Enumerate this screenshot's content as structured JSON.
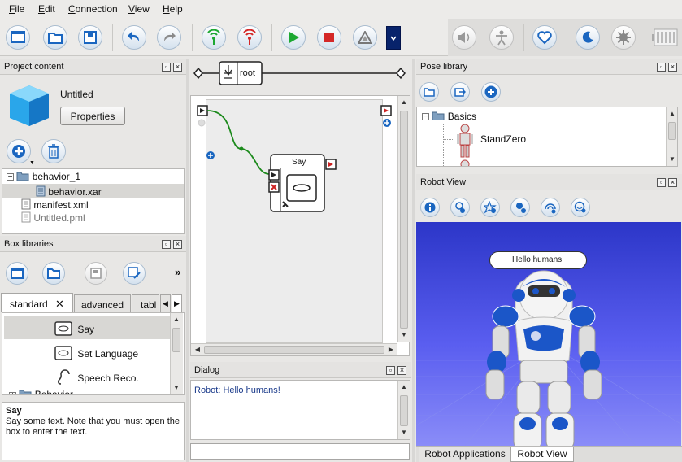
{
  "menu": {
    "file": "File",
    "edit": "Edit",
    "connection": "Connection",
    "view": "View",
    "help": "Help"
  },
  "toolbar": {
    "icons": [
      "new-file-icon",
      "open-folder-icon",
      "save-icon",
      "undo-icon",
      "redo-icon",
      "connect-icon",
      "disconnect-icon",
      "play-icon",
      "stop-icon",
      "debug-icon",
      "volume-icon",
      "stiffness-icon",
      "heart-icon",
      "sleep-icon",
      "settings-icon",
      "battery-icon"
    ],
    "accent": "#1a66c0",
    "play_color": "#1ca832",
    "stop_color": "#d42828"
  },
  "project": {
    "title": "Project content",
    "name": "Untitled",
    "properties_button": "Properties",
    "tree": [
      {
        "label": "behavior_1"
      },
      {
        "label": "behavior.xar"
      },
      {
        "label": "manifest.xml"
      },
      {
        "label": "Untitled.pml"
      }
    ]
  },
  "box_libraries": {
    "title": "Box libraries",
    "tabs": [
      "standard",
      "advanced",
      "tabl"
    ],
    "more": "»",
    "items": [
      {
        "label": "Say"
      },
      {
        "label": "Set Language"
      },
      {
        "label": "Speech Reco."
      },
      {
        "label": "Behavior"
      }
    ],
    "description_title": "Say",
    "description": "Say some text. Note that you must open the box to enter the text."
  },
  "diagram": {
    "root_label": "root",
    "box_label": "Say"
  },
  "dialog": {
    "title": "Dialog",
    "text": "Robot: Hello humans!"
  },
  "pose_library": {
    "title": "Pose library",
    "tree": [
      {
        "label": "Basics"
      },
      {
        "label": "StandZero"
      }
    ]
  },
  "robot_view": {
    "title": "Robot View",
    "speech_bubble": "Hello humans!",
    "background": "#4a4ae0",
    "tabs": [
      "Robot Applications",
      "Robot View"
    ]
  }
}
